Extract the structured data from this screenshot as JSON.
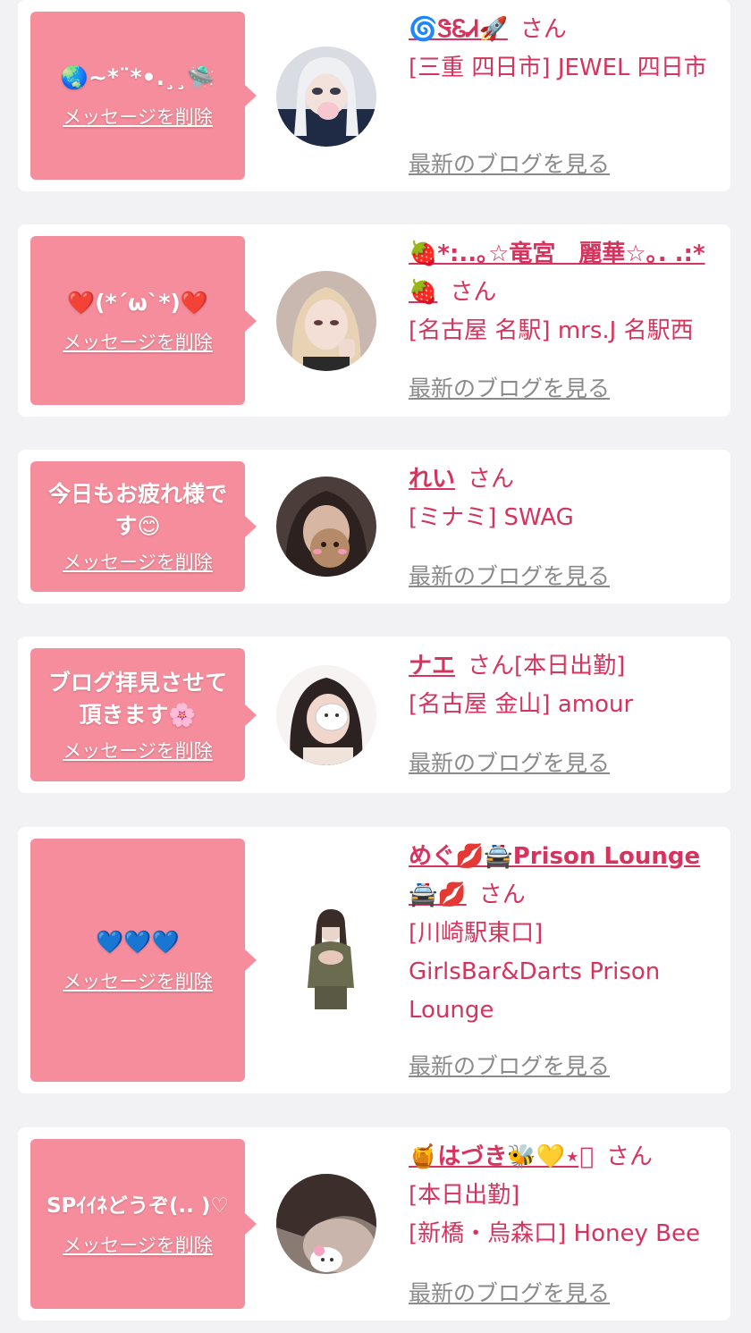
{
  "items": [
    {
      "message": "🌏~*¨*•.¸¸🛸",
      "delete_label": "メッセージを削除",
      "name": "🌀ᏕᏋᏗ🚀",
      "honorific": "さん",
      "status": "",
      "shop": "[三重 四日市] JEWEL 四日市",
      "blog_label": "最新のブログを見る"
    },
    {
      "message": "❤️(*´ω`*)❤️",
      "delete_label": "メッセージを削除",
      "name": "🍓*:..｡☆竜宮　麗華☆｡. .:*🍓",
      "honorific": "さん",
      "status": "",
      "shop": "[名古屋 名駅] mrs.J 名駅西",
      "blog_label": "最新のブログを見る"
    },
    {
      "message": "今日もお疲れ様です😊",
      "delete_label": "メッセージを削除",
      "name": "れい",
      "honorific": "さん",
      "status": "",
      "shop": "[ミナミ] SWAG",
      "blog_label": "最新のブログを見る"
    },
    {
      "message": "ブログ拝見させて頂きます🌸",
      "delete_label": "メッセージを削除",
      "name": "ナエ",
      "honorific": "さん",
      "status": "[本日出勤]",
      "shop": "[名古屋 金山] amour",
      "blog_label": "最新のブログを見る"
    },
    {
      "message": "💙💙💙",
      "delete_label": "メッセージを削除",
      "name": "めぐ💋🚔Prison Lounge🚔💋",
      "honorific": "さん",
      "status": "",
      "shop": "[川崎駅東口] GirlsBar&Darts Prison Lounge",
      "blog_label": "最新のブログを見る"
    },
    {
      "message": "SPｲｲﾈどうぞ(.. )♡",
      "delete_label": "メッセージを削除",
      "name": "🍯はづき🐝💛⋆͛",
      "honorific": "さん",
      "status": "[本日出勤]",
      "shop": "[新橋・烏森口] Honey Bee",
      "blog_label": "最新のブログを見る"
    }
  ],
  "colors": {
    "accent": "#d6345e",
    "bubble": "#f58d9c",
    "background": "#f2f2f4",
    "link_gray": "#8a8a8a"
  }
}
